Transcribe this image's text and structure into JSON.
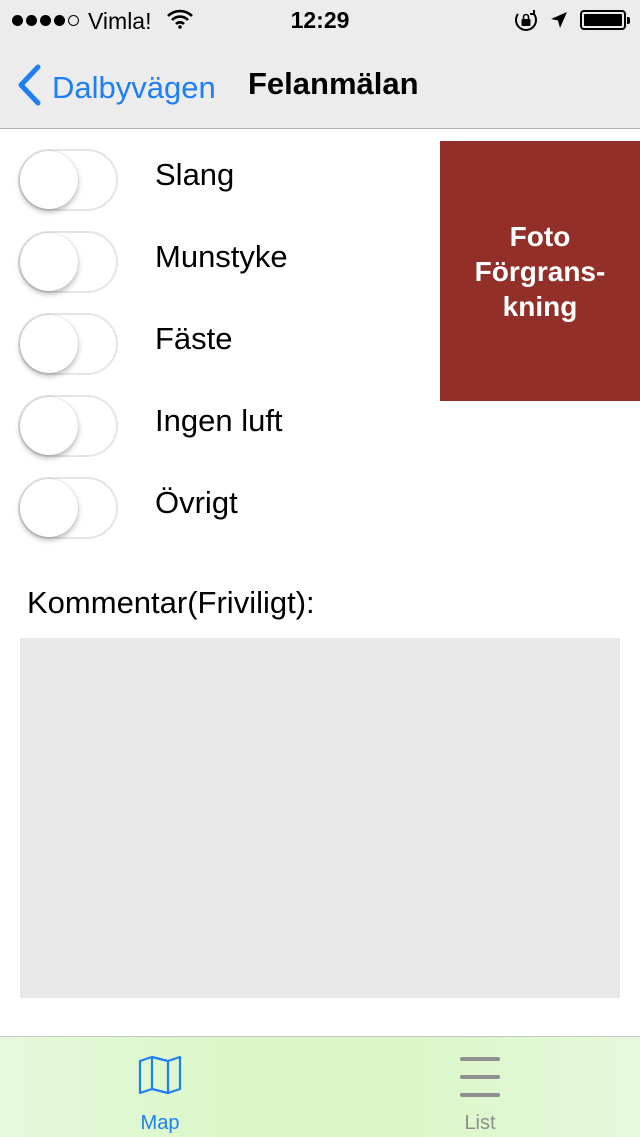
{
  "status_bar": {
    "carrier": "Vimla!",
    "time": "12:29",
    "signal_bars_filled": 4,
    "signal_bars_total": 5
  },
  "nav": {
    "back_label": "Dalbyvägen",
    "title": "Felanmälan"
  },
  "toggles": [
    {
      "label": "Slang",
      "on": false
    },
    {
      "label": "Munstyke",
      "on": false
    },
    {
      "label": "Fäste",
      "on": false
    },
    {
      "label": "Ingen luft",
      "on": false
    },
    {
      "label": "Övrigt",
      "on": false
    }
  ],
  "photo_button": {
    "label": "Foto\nFörgrans-\nkning",
    "color": "#912f28"
  },
  "comment": {
    "label": "Kommentar(Friviligt):",
    "value": ""
  },
  "tabbar": {
    "tabs": [
      {
        "label": "Map",
        "icon": "map-icon",
        "active": true
      },
      {
        "label": "List",
        "icon": "list-icon",
        "active": false
      }
    ]
  },
  "colors": {
    "accent": "#1e7ef5",
    "photo_button": "#912f28",
    "bar_background": "#ececec",
    "comment_background": "#e9e9e9"
  }
}
